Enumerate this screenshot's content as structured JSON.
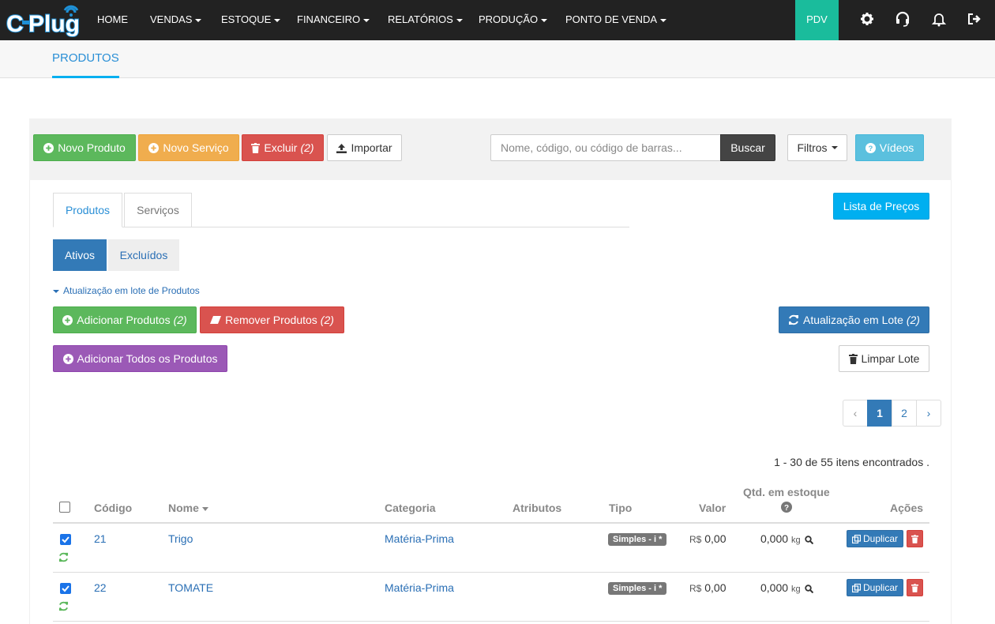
{
  "brand": {
    "logo_text": "CPlug",
    "accent": "#00aff0",
    "nav_bg": "#222222"
  },
  "nav": {
    "items": [
      "HOME",
      "VENDAS",
      "ESTOQUE",
      "FINANCEIRO",
      "RELATÓRIOS",
      "PRODUÇÃO",
      "PONTO DE VENDA"
    ],
    "pdv": "PDV",
    "icons": [
      "gear-icon",
      "headset-icon",
      "bell-icon",
      "logout-icon"
    ]
  },
  "subheader": {
    "tab": "PRODUTOS"
  },
  "toolbar": {
    "new_product": "Novo Produto",
    "new_service": "Novo Serviço",
    "delete": "Excluir",
    "delete_count": "(2)",
    "import": "Importar",
    "search_placeholder": "Nome, código, ou código de barras...",
    "search_button": "Buscar",
    "filters": "Filtros",
    "videos": "Vídeos"
  },
  "tabs": {
    "products": "Produtos",
    "services": "Serviços"
  },
  "price_list": "Lista de Preços",
  "status_pills": {
    "active": "Ativos",
    "deleted": "Excluídos"
  },
  "batch": {
    "toggle": "Atualização em lote de Produtos",
    "add": "Adicionar Produtos",
    "add_count": "(2)",
    "remove": "Remover Produtos",
    "remove_count": "(2)",
    "update": "Atualização em Lote",
    "update_count": "(2)",
    "add_all": "Adicionar Todos os Produtos",
    "clear": "Limpar Lote"
  },
  "pagination": {
    "prev": "‹",
    "pages": [
      "1",
      "2"
    ],
    "current": "1",
    "next": "›"
  },
  "result_count": "1 - 30 de 55 itens encontrados .",
  "table": {
    "headers": {
      "code": "Código",
      "name": "Nome",
      "category": "Categoria",
      "attributes": "Atributos",
      "type": "Tipo",
      "value": "Valor",
      "stock_line1": "Qtd. em estoque",
      "actions": "Ações"
    },
    "rows": [
      {
        "checked": true,
        "code": "21",
        "name": "Trigo",
        "category": "Matéria-Prima",
        "attributes": "",
        "type": "Simples - i *",
        "currency": "R$",
        "value": "0,00",
        "stock": "0,000",
        "unit": "kg",
        "duplicate": "Duplicar"
      },
      {
        "checked": true,
        "code": "22",
        "name": "TOMATE",
        "category": "Matéria-Prima",
        "attributes": "",
        "type": "Simples - i *",
        "currency": "R$",
        "value": "0,00",
        "stock": "0,000",
        "unit": "kg",
        "duplicate": "Duplicar"
      }
    ]
  }
}
